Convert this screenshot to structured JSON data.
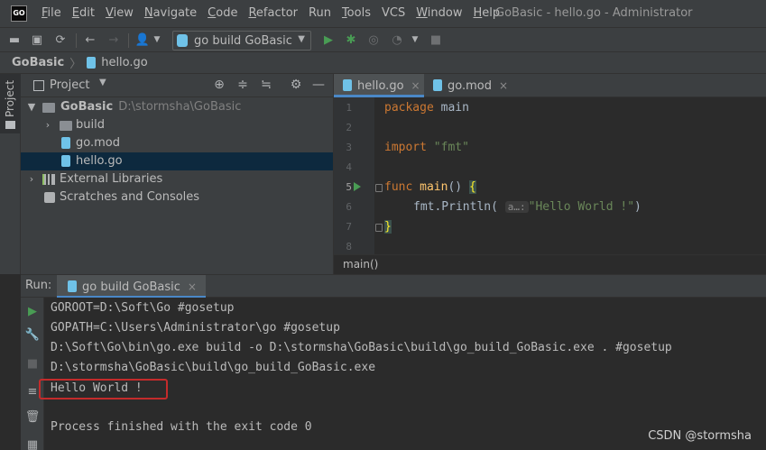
{
  "app": {
    "logo_text": "GO",
    "window_title": "GoBasic - hello.go - Administrator"
  },
  "menu": [
    {
      "label": "File",
      "mnemonic": "F",
      "rest": "ile"
    },
    {
      "label": "Edit",
      "mnemonic": "E",
      "rest": "dit"
    },
    {
      "label": "View",
      "mnemonic": "V",
      "rest": "iew"
    },
    {
      "label": "Navigate",
      "mnemonic": "N",
      "rest": "avigate"
    },
    {
      "label": "Code",
      "mnemonic": "C",
      "rest": "ode"
    },
    {
      "label": "Refactor",
      "mnemonic": "R",
      "rest": "efactor"
    },
    {
      "label": "Run",
      "mnemonic": "",
      "rest": "Run"
    },
    {
      "label": "Tools",
      "mnemonic": "T",
      "rest": "ools"
    },
    {
      "label": "VCS",
      "mnemonic": "",
      "rest": "VCS"
    },
    {
      "label": "Window",
      "mnemonic": "W",
      "rest": "indow"
    },
    {
      "label": "Help",
      "mnemonic": "H",
      "rest": "elp"
    }
  ],
  "toolbar": {
    "run_config": "go build GoBasic"
  },
  "navbar": {
    "project": "GoBasic",
    "file": "hello.go"
  },
  "project_panel": {
    "stripe_label": "Project",
    "title": "Project",
    "tree": [
      {
        "label": "GoBasic",
        "path": "D:\\stormsha\\GoBasic"
      },
      {
        "label": "build"
      },
      {
        "label": "go.mod"
      },
      {
        "label": "hello.go"
      },
      {
        "label": "External Libraries"
      },
      {
        "label": "Scratches and Consoles"
      }
    ]
  },
  "editor": {
    "tabs": [
      {
        "label": "hello.go",
        "close": "×"
      },
      {
        "label": "go.mod",
        "close": "×"
      }
    ],
    "line_numbers": [
      "1",
      "2",
      "3",
      "4",
      "5",
      "6",
      "7",
      "8"
    ],
    "code": {
      "l1_kw": "package",
      "l1_name": " main",
      "l3_kw": "import",
      "l3_str": " \"fmt\"",
      "l5_kw": "func",
      "l5_fn": " main",
      "l5_rest": "() ",
      "l5_brace": "{",
      "l6_call": "fmt.Println(",
      "l6_hint": "a…:",
      "l6_str": "\"Hello World !\"",
      "l6_end": ")",
      "l7_brace": "}"
    },
    "breadcrumb": "main()"
  },
  "run_panel": {
    "label": "Run:",
    "tab": "go build GoBasic",
    "tab_close": "×",
    "console": [
      "GOROOT=D:\\Soft\\Go #gosetup",
      "GOPATH=C:\\Users\\Administrator\\go #gosetup",
      "D:\\Soft\\Go\\bin\\go.exe build -o D:\\stormsha\\GoBasic\\build\\go_build_GoBasic.exe . #gosetup",
      "D:\\stormsha\\GoBasic\\build\\go_build_GoBasic.exe",
      "Hello World !",
      "",
      "Process finished with the exit code 0"
    ],
    "watermark": "CSDN @stormsha"
  },
  "colors": {
    "keyword": "#cc7832",
    "function": "#ffc66d",
    "string": "#6a8759",
    "highlight_box": "#c42b2b",
    "run_green": "#499c54"
  }
}
